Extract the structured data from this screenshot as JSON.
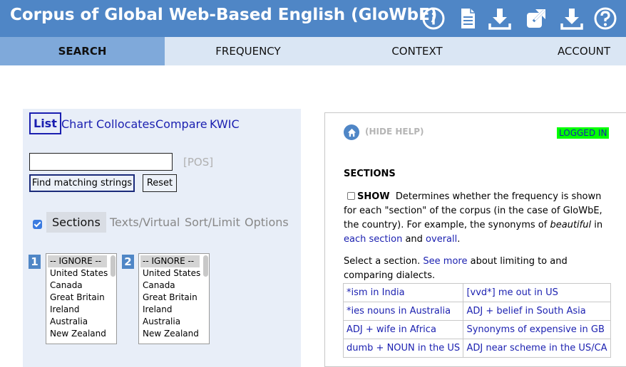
{
  "header": {
    "title": "Corpus of Global Web-Based English (GloWbE)",
    "icons": [
      "info-icon",
      "document-icon",
      "download-icon",
      "external-link-icon",
      "download-icon",
      "help-icon"
    ]
  },
  "nav": {
    "tabs": [
      {
        "label": "SEARCH",
        "active": true
      },
      {
        "label": "FREQUENCY",
        "active": false
      },
      {
        "label": "CONTEXT",
        "active": false
      },
      {
        "label": "ACCOUNT",
        "active": false
      }
    ]
  },
  "search": {
    "modes": [
      "List",
      "Chart",
      "Collocates",
      "Compare",
      "KWIC"
    ],
    "active_mode": "List",
    "input_value": "",
    "pos_label": "[POS]",
    "find_button": "Find matching strings",
    "reset_button": "Reset",
    "subtabs": [
      "Sections",
      "Texts/Virtual",
      "Sort/Limit",
      "Options"
    ],
    "active_subtab": "Sections",
    "sections_checked": true,
    "list1_number": "1",
    "list2_number": "2",
    "list_options": [
      "-- IGNORE --",
      "United States",
      "Canada",
      "Great Britain",
      "Ireland",
      "Australia",
      "New Zealand"
    ]
  },
  "help": {
    "hide_help": "(HIDE HELP)",
    "logged_in": "LOGGED IN",
    "section_title": "SECTIONS",
    "show_label": "SHOW",
    "desc_part1": "Determines whether the frequency is shown for each \"section\" of the corpus (in the case of GloWbE, the country). For example, the synonyms of ",
    "desc_em": "beautiful",
    "desc_part2": " in ",
    "desc_link1": "each section",
    "desc_part3": " and ",
    "desc_link2": "overall",
    "desc_part4": ".",
    "select_part1": "Select a section. ",
    "select_link": "See more",
    "select_part2": " about limiting to and comparing dialects.",
    "examples": [
      [
        "*ism in India",
        "[vvd*] me out in US"
      ],
      [
        "*ies nouns in Australia",
        "ADJ + belief in South Asia"
      ],
      [
        "ADJ + wife in Africa",
        "Synonyms of expensive in GB"
      ],
      [
        "dumb + NOUN in the US",
        "ADJ near scheme in the US/CA"
      ]
    ]
  },
  "colors": {
    "header_bg": "#4f86c6",
    "nav_bg": "#dae6f4",
    "nav_active_bg": "#7fa9da",
    "link": "#1a1fb0",
    "logged_in_bg": "#00ff00"
  }
}
